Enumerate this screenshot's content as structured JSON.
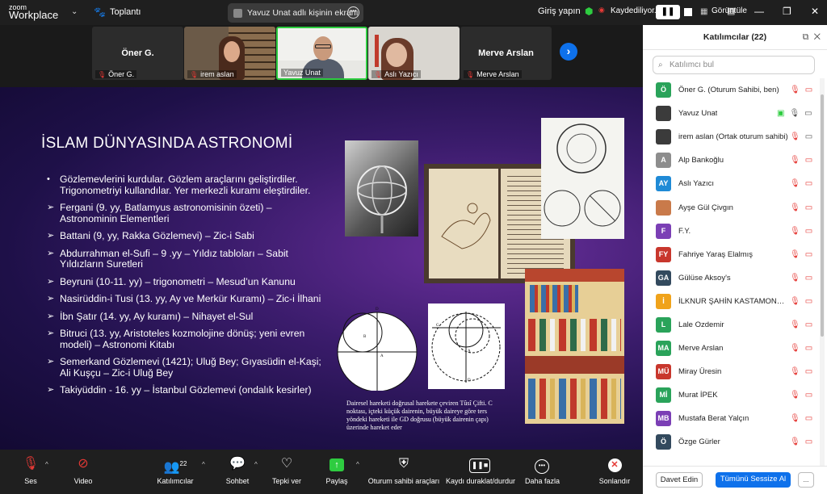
{
  "topbar": {
    "logo_line1": "zoom",
    "logo_line2": "Workplace",
    "meeting_title": "Toplantı",
    "share_status": "Yavuz Unat adlı kişinin ekranı",
    "signin": "Giriş yapın",
    "recording": "Kaydediliyor...",
    "view": "Görüntüle"
  },
  "strip": {
    "tiles": [
      {
        "big": "Öner G.",
        "name": "Öner G."
      },
      {
        "big": "",
        "name": "irem aslan"
      },
      {
        "big": "",
        "name": "Yavuz Unat"
      },
      {
        "big": "",
        "name": "Aslı Yazıcı"
      },
      {
        "big": "Merve Arslan",
        "name": "Merve Arslan"
      }
    ]
  },
  "slide": {
    "title": "İSLAM DÜNYASINDA ASTRONOMİ",
    "bullets": [
      "Gözlemevlerini kurdular. Gözlem araçlarını geliştirdiler. Trigonometriyi kullandılar. Yer merkezli kuramı eleştirdiler.",
      "Fergani (9. yy, Batlamyus astronomisinin özeti) – Astronominin Elementleri",
      "Battani (9, yy, Rakka Gözlemevi) – Zic-i Sabi",
      "Abdurrahman el-Sufi – 9 .yy – Yıldız tabloları – Sabit Yıldızların Suretleri",
      "Beyruni (10-11. yy) – trigonometri – Mesud’un Kanunu",
      "Nasirüddin-i Tusi (13. yy, Ay ve Merkür Kuramı) – Zic-i İlhani",
      "İbn Şatır (14. yy, Ay kuramı) – Nihayet el-Sul",
      "Bitruci (13. yy, Aristoteles kozmolojine dönüş; yeni evren modeli) – Astronomi Kitabı",
      "Semerkand Gözlemevi (1421); Uluğ Bey; Gıyasüdin el-Kaşi; Ali Kuşçu – Zic-i Uluğ Bey",
      "Takiyüddin - 16. yy – İstanbul Gözlemevi (ondalık kesirler)"
    ],
    "caption": "Dairesel hareketi doğrusal harekete çeviren Tûsî Çifti. C noktası, içteki küçük dairenin, büyük daireye göre ters yöndeki hareketi ile GD doğrusu (büyük dairenin çapı) üzerinde hareket eder"
  },
  "toolbar": {
    "audio": "Ses",
    "video": "Video",
    "participants": "Katılımcılar",
    "participants_count": "22",
    "chat": "Sohbet",
    "react": "Tepki ver",
    "share": "Paylaş",
    "host_tools": "Oturum sahibi araçları",
    "pause_recording": "Kaydı duraklat/durdur",
    "more": "Daha fazla",
    "end": "Sonlandır"
  },
  "panel": {
    "title": "Katılımcılar (22)",
    "search_placeholder": "Katılımcı bul",
    "participants": [
      {
        "initials": "Ö",
        "name": "Öner G. (Oturum Sahibi, ben)",
        "color": "#2aa35a"
      },
      {
        "initials": "",
        "name": "Yavuz Unat",
        "color": "#3b3b3b"
      },
      {
        "initials": "",
        "name": "irem aslan (Ortak oturum sahibi)",
        "color": "#3b3b3b"
      },
      {
        "initials": "A",
        "name": "Alp Bankoğlu",
        "color": "#8d8d8d"
      },
      {
        "initials": "AY",
        "name": "Aslı Yazıcı",
        "color": "#1f8ad6"
      },
      {
        "initials": "",
        "name": "Ayşe Gül Çivgın",
        "color": "#c97a4a"
      },
      {
        "initials": "F",
        "name": "F.Y.",
        "color": "#7b3fb5"
      },
      {
        "initials": "FY",
        "name": "Fahriye Yaraş Elalmış",
        "color": "#c8372d"
      },
      {
        "initials": "GA",
        "name": "Gülüse Aksoy's",
        "color": "#334a5e"
      },
      {
        "initials": "İ",
        "name": "İLKNUR ŞAHİN KASTAMONU UNİV...",
        "color": "#f0a31b"
      },
      {
        "initials": "L",
        "name": "Lale Ozdemir",
        "color": "#2aa35a"
      },
      {
        "initials": "MA",
        "name": "Merve Arslan",
        "color": "#2aa35a"
      },
      {
        "initials": "MÜ",
        "name": "Miray Üresin",
        "color": "#c8372d"
      },
      {
        "initials": "Mİ",
        "name": "Murat İPEK",
        "color": "#2aa35a"
      },
      {
        "initials": "MB",
        "name": "Mustafa Berat Yalçın",
        "color": "#7b3fb5"
      },
      {
        "initials": "Ö",
        "name": "Özge Gürler",
        "color": "#334a5e"
      },
      {
        "initials": "",
        "name": "",
        "color": "#2aa35a"
      }
    ],
    "invite": "Davet Edin",
    "mute_all": "Tümünü Sessize Al",
    "more": "..."
  }
}
